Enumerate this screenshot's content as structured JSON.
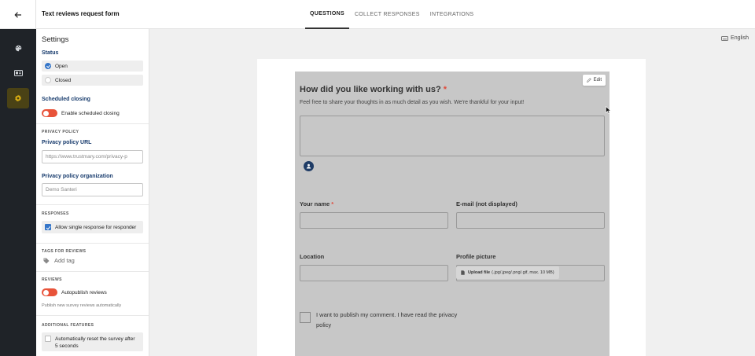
{
  "header": {
    "title": "Text reviews request form",
    "tabs": [
      {
        "label": "QUESTIONS",
        "active": true
      },
      {
        "label": "COLLECT RESPONSES",
        "active": false
      },
      {
        "label": "INTEGRATIONS",
        "active": false
      }
    ]
  },
  "rail": {
    "items": [
      {
        "icon": "palette-icon",
        "active": false
      },
      {
        "icon": "id-card-icon",
        "active": false
      },
      {
        "icon": "gear-icon",
        "active": true
      }
    ],
    "accent_color": "#e0b312"
  },
  "settings": {
    "title": "Settings",
    "status": {
      "title": "Status",
      "options": [
        {
          "label": "Open",
          "selected": true
        },
        {
          "label": "Closed",
          "selected": false
        }
      ]
    },
    "scheduled_closing": {
      "title": "Scheduled closing",
      "toggle_label": "Enable scheduled closing"
    },
    "privacy": {
      "caption": "PRIVACY POLICY",
      "url_label": "Privacy policy URL",
      "url_placeholder": "https://www.trustmary.com/privacy-p",
      "org_label": "Privacy policy organization",
      "org_placeholder": "Demo Santeri"
    },
    "responses": {
      "caption": "RESPONSES",
      "checkbox_label": "Allow single response for responder"
    },
    "tags": {
      "caption": "TAGS FOR REVIEWS",
      "add_label": "Add tag"
    },
    "reviews": {
      "caption": "REVIEWS",
      "toggle_label": "Autopublish reviews",
      "note": "Publish new survey reviews automatically"
    },
    "additional": {
      "caption": "ADDITIONAL FEATURES",
      "checkbox_label_line1": "Automatically reset the survey after",
      "checkbox_label_line2": "5 seconds"
    }
  },
  "main": {
    "language": "English",
    "form": {
      "edit_label": "Edit",
      "question": "How did you like working with us?",
      "required_mark": "*",
      "description": "Feel free to share your thoughts in as much detail as you wish. We're thankful for your input!",
      "name_label": "Your name",
      "email_label": "E-mail (not displayed)",
      "location_label": "Location",
      "picture_label": "Profile picture",
      "upload_label": "Upload file",
      "upload_hint": "(.jpg/.jpeg/.png/.gif, max. 10 MB)",
      "consent_text": "I want to publish my comment. I have read the privacy policy"
    }
  },
  "colors": {
    "rail_bg": "#1f2328",
    "link_blue": "#163a6c",
    "toggle_off": "#e8533a",
    "check_on": "#3576c9",
    "form_overlay": "#c7c7c7"
  }
}
